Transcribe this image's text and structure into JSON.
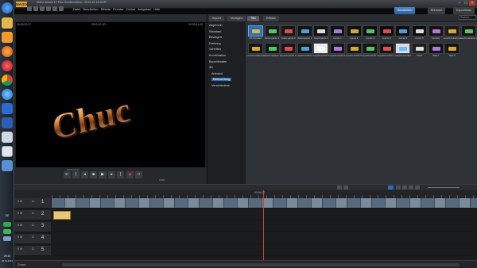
{
  "app": {
    "logo": "MAGIX",
    "title": "Video deluxe 17 Plus Sonderedition - 2013-10-18.MVP*",
    "menu": [
      "Datei",
      "Bearbeiten",
      "Effekte",
      "Fenster",
      "Online",
      "Aufgaben",
      "Hilfe"
    ],
    "modes": {
      "edit": "Bearbeiten",
      "burn": "Brennen",
      "export": "Exportieren"
    }
  },
  "preview": {
    "left_time": "00:00:20:17",
    "center_title": "2013-10-20 *",
    "right_time": "00:09:41:05",
    "overlay_word": "Chuc",
    "counter": "00:04:20:17",
    "zoom": "100%"
  },
  "panel": {
    "tabs": [
      "Import",
      "Vorlagen",
      "Titel",
      "Effekte"
    ],
    "active_tab": "Titel",
    "search_placeholder": "Suchen...",
    "categories": [
      {
        "label": "Allgemein",
        "indent": false,
        "selected": false
      },
      {
        "label": "Standard",
        "indent": false,
        "selected": false
      },
      {
        "label": "Bewegen",
        "indent": false,
        "selected": false
      },
      {
        "label": "Drehung",
        "indent": false,
        "selected": false
      },
      {
        "label": "Schriften",
        "indent": false,
        "selected": false
      },
      {
        "label": "Kombination",
        "indent": false,
        "selected": false
      },
      {
        "label": "Bauchbinden",
        "indent": false,
        "selected": false
      },
      {
        "label": "3D",
        "indent": false,
        "selected": false
      },
      {
        "label": "Animiert",
        "indent": true,
        "selected": false
      },
      {
        "label": "Beleuchtung",
        "indent": true,
        "selected": true
      },
      {
        "label": "Verschiedene",
        "indent": true,
        "selected": false
      }
    ],
    "tiles_row1": [
      {
        "label": "3D-Schatten",
        "color": "#2f6fb8"
      },
      {
        "label": "Avant-garde 1",
        "color": "#1a1a1a"
      },
      {
        "label": "Avant-garde 2",
        "color": "#151515"
      },
      {
        "label": "Avant-garde 3",
        "color": "#141414"
      },
      {
        "label": "Avant-garde 4",
        "color": "#121212"
      },
      {
        "label": "Comic 1",
        "color": "#101010"
      },
      {
        "label": "Comic 2",
        "color": "#0f0f0f"
      },
      {
        "label": "Comic 3",
        "color": "#0e0e0e"
      },
      {
        "label": "Comic 4",
        "color": "#0d0d0d"
      },
      {
        "label": "Comic 5",
        "color": "#0d0d0d"
      },
      {
        "label": "Comic 6",
        "color": "#0d0d0d"
      },
      {
        "label": "Fantasy",
        "color": "#1a1410"
      },
      {
        "label": "Leucht-reklame 1",
        "color": "#1b1b1b"
      },
      {
        "label": "Leucht-reklame 2",
        "color": "#141414"
      }
    ],
    "tiles_row2": [
      {
        "label": "Leucht-reklame 3",
        "color": "#141414"
      },
      {
        "label": "Leucht-reklame 4",
        "color": "#141414"
      },
      {
        "label": "Leucht-schrift 1",
        "color": "#161616"
      },
      {
        "label": "Leucht-schrift 2",
        "color": "#141414"
      },
      {
        "label": "Leucht-schrift 3",
        "color": "#e9ecef"
      },
      {
        "label": "Leucht-schrift 4",
        "color": "#141414"
      },
      {
        "label": "Leucht-schrift 5",
        "color": "#141414"
      },
      {
        "label": "Leucht-schrift 6",
        "color": "#141414"
      },
      {
        "label": "Leucht-schrift 7",
        "color": "#141414"
      },
      {
        "label": "Leucht-schrift 8",
        "color": "#d8dde2"
      },
      {
        "label": "Tribal",
        "color": "#1e1e1e"
      },
      {
        "label": "Wild 1",
        "color": "#131313"
      },
      {
        "label": "Wild 2",
        "color": "#151515"
      }
    ]
  },
  "timeline": {
    "tracks": [
      {
        "number": "1",
        "flags": "S  M"
      },
      {
        "number": "2",
        "flags": "S  M"
      },
      {
        "number": "3",
        "flags": "S  M"
      },
      {
        "number": "4",
        "flags": "S  M"
      },
      {
        "number": "5",
        "flags": "S  M"
      }
    ],
    "position_label": "00:04:20",
    "zoom_label": "Zoom"
  },
  "taskbar": {
    "time": "09:10",
    "date": "20.11.2013",
    "lang": "DE"
  }
}
